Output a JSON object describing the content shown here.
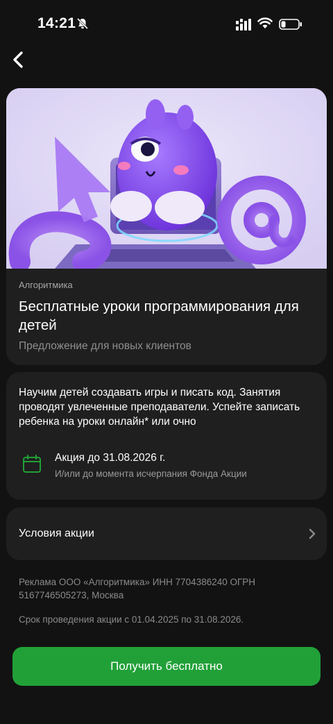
{
  "status_bar": {
    "time": "14:21",
    "icons": [
      "mute-bell-icon",
      "signal-icon",
      "wifi-icon",
      "battery-icon"
    ]
  },
  "nav": {
    "back_icon": "chevron-left-icon"
  },
  "hero": {
    "brand": "Алгоритмика",
    "title": "Бесплатные уроки программирования для детей",
    "subtitle": "Предложение для новых клиентов"
  },
  "info": {
    "description": "Научим детей создавать игры и писать код. Занятия проводят увлеченные преподаватели. Успейте записать ребенка на уроки онлайн* или очно",
    "promo_date": "Акция до 31.08.2026 г.",
    "promo_note": "И/или до момента исчерпания Фонда Акции",
    "icon": "calendar-icon"
  },
  "terms": {
    "label": "Условия акции",
    "icon": "chevron-right-icon"
  },
  "footer": {
    "ad": "Реклама ООО «Алгоритмика» ИНН 7704386240 ОГРН 5167746505273, Москва",
    "period": "Срок проведения акции с 01.04.2025 по 31.08.2026."
  },
  "cta": {
    "label": "Получить бесплатно"
  },
  "colors": {
    "background": "#121212",
    "card": "#1f1f1f",
    "accent_green": "#21a038",
    "hero_bg": "#ddd6f3",
    "mascot_purple": "#8b4cf0"
  }
}
